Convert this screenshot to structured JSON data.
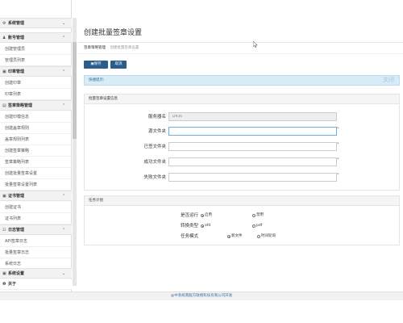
{
  "sidebar": {
    "sections": [
      {
        "icon": "⚙",
        "label": "系统管理",
        "chevron": "⌄"
      },
      {
        "icon": "♟",
        "label": "账号管理",
        "chevron": "⌃",
        "items": [
          "创建管理员",
          "管理员列表"
        ]
      },
      {
        "icon": "▣",
        "label": "印章管理",
        "chevron": "⌃",
        "items": [
          "创建印章",
          "印章列表"
        ]
      },
      {
        "icon": "▤",
        "label": "签章策略管理",
        "chevron": "⌃",
        "items": [
          "创建印模信息",
          "创建盖章规则",
          "盖章规则列表",
          "创建签章策略",
          "签章策略列表",
          "创建批量签章设置",
          "批量签章设置列表"
        ]
      },
      {
        "icon": "▣",
        "label": "证书管理",
        "chevron": "⌃",
        "items": [
          "创建证书",
          "证书列表"
        ]
      },
      {
        "icon": "☷",
        "label": "日志管理",
        "chevron": "⌃",
        "items": [
          "API签章日志",
          "批量签章日志",
          "系统日志"
        ]
      },
      {
        "icon": "▣",
        "label": "系统设置",
        "chevron": "⌄"
      },
      {
        "icon": "❶",
        "label": "关于",
        "chevron": ""
      }
    ]
  },
  "main": {
    "title": "创建批量签章设置",
    "breadcrumb": [
      "签章策略管理",
      "创建批量签章设置"
    ],
    "buttons": {
      "save": "▣保存",
      "cancel": "取消"
    },
    "alert": {
      "text": "快捷提示:",
      "close": "关闭"
    },
    "basic_panel": {
      "title": "批量签章设置信息",
      "fields": [
        {
          "label": "服务器名",
          "value": "D936",
          "placeholder": ""
        },
        {
          "label": "源文件夹",
          "value": "",
          "placeholder": "",
          "required": "*"
        },
        {
          "label": "已签文件夹",
          "value": "",
          "placeholder": "",
          "required": "*"
        },
        {
          "label": "成功文件夹",
          "value": "",
          "placeholder": "",
          "required": "*"
        },
        {
          "label": "失败文件夹",
          "value": "",
          "placeholder": "",
          "required": "*"
        }
      ]
    },
    "task_panel": {
      "title": "任务计划",
      "rows": [
        {
          "label": "是否运行",
          "options": [
            "启用",
            "禁用"
          ],
          "selected": 0
        },
        {
          "label": "转换类型",
          "options": [
            "ofd",
            "pdf"
          ],
          "selected": 0
        },
        {
          "label": "任务模式",
          "options": [
            "新文件",
            "时间轮询"
          ],
          "selected": 0
        }
      ]
    }
  },
  "footer": {
    "text": "@中系统南服方联络科技有限公司开发"
  }
}
